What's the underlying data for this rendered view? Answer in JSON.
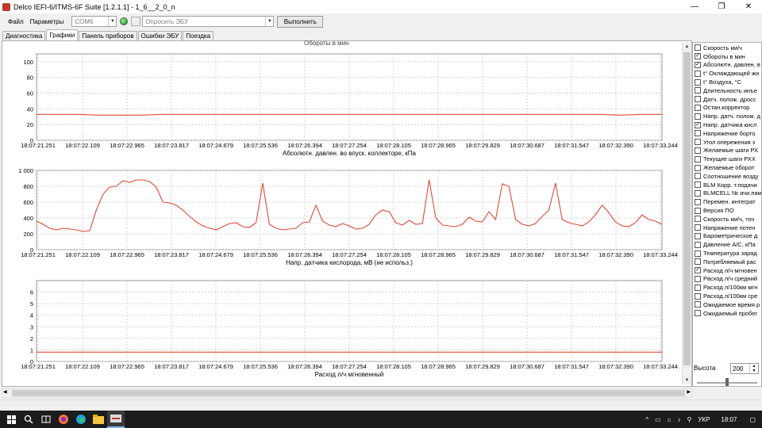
{
  "window": {
    "title": "Delco IEFI-6/ITMS-6F Suite [1.2.1.1] - 1_6__2_0_n",
    "minimize": "—",
    "restore": "❐",
    "close": "✕"
  },
  "toolbar": {
    "menu": [
      "Файл",
      "Параметры"
    ],
    "port": "COM6",
    "ecu_query": "Опросить ЭБУ",
    "execute_label": "Выполнить"
  },
  "tabs": [
    "Диагностика",
    "Графики",
    "Панель приборов",
    "Ошибки ЭБУ",
    "Поездка"
  ],
  "active_tab": 1,
  "charts": {
    "top_cut_label": "Обороты в мин",
    "time_labels": [
      "18:07:21.251",
      "18:07:22.109",
      "18:07:22.965",
      "18:07:23.817",
      "18:07:24.679",
      "18:07:25.536",
      "18:07:26.394",
      "18:07:27.254",
      "18:07:28.105",
      "18:07:28.965",
      "18:07:29.829",
      "18:07:30.687",
      "18:07:31.547",
      "18:07:32.390",
      "18:07:33.244"
    ],
    "chart1": {
      "xlabel": "Абсолютн. давлен. во впуск. коллекторе, кПа",
      "yticks": [
        "0",
        "20",
        "40",
        "60",
        "80",
        "100"
      ]
    },
    "chart2": {
      "xlabel": "Напр. датчика кислорода, мВ (не использ.)",
      "yticks": [
        "0",
        "200",
        "400",
        "600",
        "800",
        "1 000"
      ]
    },
    "chart3": {
      "xlabel": "Расход л/ч мгновенный",
      "yticks": [
        "0",
        "1",
        "2",
        "3",
        "4",
        "5",
        "6"
      ]
    }
  },
  "chart_data": [
    {
      "type": "line",
      "xlabel": "Абсолютн. давлен. во впуск. коллекторе, кПа",
      "ylim": [
        0,
        110
      ],
      "series": [
        {
          "values": [
            33,
            33,
            33,
            32,
            32,
            32,
            33,
            33,
            33,
            33,
            33,
            33,
            33,
            33,
            33,
            33,
            33,
            33,
            33,
            33,
            33,
            33,
            33,
            33,
            33,
            33,
            33,
            33,
            32,
            33,
            33
          ]
        }
      ]
    },
    {
      "type": "line",
      "xlabel": "Напр. датчика кислорода, мВ (не использ.)",
      "ylim": [
        0,
        1000
      ],
      "series": [
        {
          "values": [
            360,
            320,
            270,
            250,
            270,
            260,
            250,
            230,
            240,
            500,
            700,
            790,
            800,
            870,
            850,
            880,
            880,
            860,
            790,
            600,
            590,
            560,
            500,
            420,
            350,
            300,
            270,
            250,
            290,
            330,
            340,
            290,
            280,
            340,
            840,
            320,
            270,
            250,
            260,
            270,
            340,
            350,
            560,
            360,
            310,
            290,
            330,
            300,
            260,
            270,
            320,
            440,
            500,
            480,
            340,
            310,
            370,
            320,
            330,
            880,
            400,
            310,
            300,
            290,
            320,
            410,
            360,
            350,
            480,
            380,
            830,
            800,
            380,
            320,
            300,
            330,
            420,
            500,
            840,
            380,
            340,
            320,
            300,
            350,
            440,
            560,
            470,
            350,
            300,
            290,
            340,
            440,
            380,
            360,
            320
          ]
        }
      ]
    },
    {
      "type": "line",
      "xlabel": "Расход л/ч мгновенный",
      "ylim": [
        0,
        7
      ],
      "series": [
        {
          "values": [
            0.8,
            0.8,
            0.8,
            0.8,
            0.8,
            0.8,
            0.8,
            0.8,
            0.8,
            0.8,
            0.8,
            0.8,
            0.8,
            0.8,
            0.8,
            0.8,
            0.8,
            0.8,
            0.8,
            0.8,
            0.8
          ]
        }
      ]
    }
  ],
  "parameters": [
    {
      "label": "Скорость км/ч",
      "checked": false
    },
    {
      "label": "Обороты в мин",
      "checked": true
    },
    {
      "label": "Абсолютн. давлен. в",
      "checked": true
    },
    {
      "label": "t° Охлаждающей жи",
      "checked": false
    },
    {
      "label": "t° Воздуха, °C",
      "checked": false
    },
    {
      "label": "Длительность инъе",
      "checked": false
    },
    {
      "label": "Датч. полож. дросс",
      "checked": false
    },
    {
      "label": "Остан.корректор",
      "checked": false
    },
    {
      "label": "Напр. датч. полож. д",
      "checked": false
    },
    {
      "label": "Напр. датчика кисл",
      "checked": true
    },
    {
      "label": "Напряжение борто",
      "checked": false
    },
    {
      "label": "Угол опережения з",
      "checked": false
    },
    {
      "label": "Желаемые шаги РХ",
      "checked": false
    },
    {
      "label": "Текущие шаги РХХ",
      "checked": false
    },
    {
      "label": "Желаемые оборот",
      "checked": false
    },
    {
      "label": "Соотношение возду",
      "checked": false
    },
    {
      "label": "BLM Корр. т.подачи",
      "checked": false
    },
    {
      "label": "BLMCELL № ячи.пам",
      "checked": false
    },
    {
      "label": "Перемен. интеграт",
      "checked": false
    },
    {
      "label": "Версия ПО",
      "checked": false
    },
    {
      "label": "Скорость км/ч, точ",
      "checked": false
    },
    {
      "label": "Напряжение потен",
      "checked": false
    },
    {
      "label": "Барометрическое д",
      "checked": false
    },
    {
      "label": "Давление А/С, кПа",
      "checked": false
    },
    {
      "label": "Температура заряд",
      "checked": false
    },
    {
      "label": "Потребляемый рас",
      "checked": false
    },
    {
      "label": "Расход л/ч мгновен",
      "checked": true
    },
    {
      "label": "Расход л/ч средний",
      "checked": false
    },
    {
      "label": "Расход л/100км мгн",
      "checked": false
    },
    {
      "label": "Расход л/100км сре",
      "checked": false
    },
    {
      "label": "Ожидаемое время р",
      "checked": false
    },
    {
      "label": "Ожидаемый пробег",
      "checked": false
    }
  ],
  "height_control": {
    "label": "Высота",
    "value": "200"
  },
  "taskbar": {
    "lang": "УКР",
    "time": "18:07"
  },
  "colors": {
    "series": "#e04a3a",
    "grid": "#c8c8c8"
  }
}
